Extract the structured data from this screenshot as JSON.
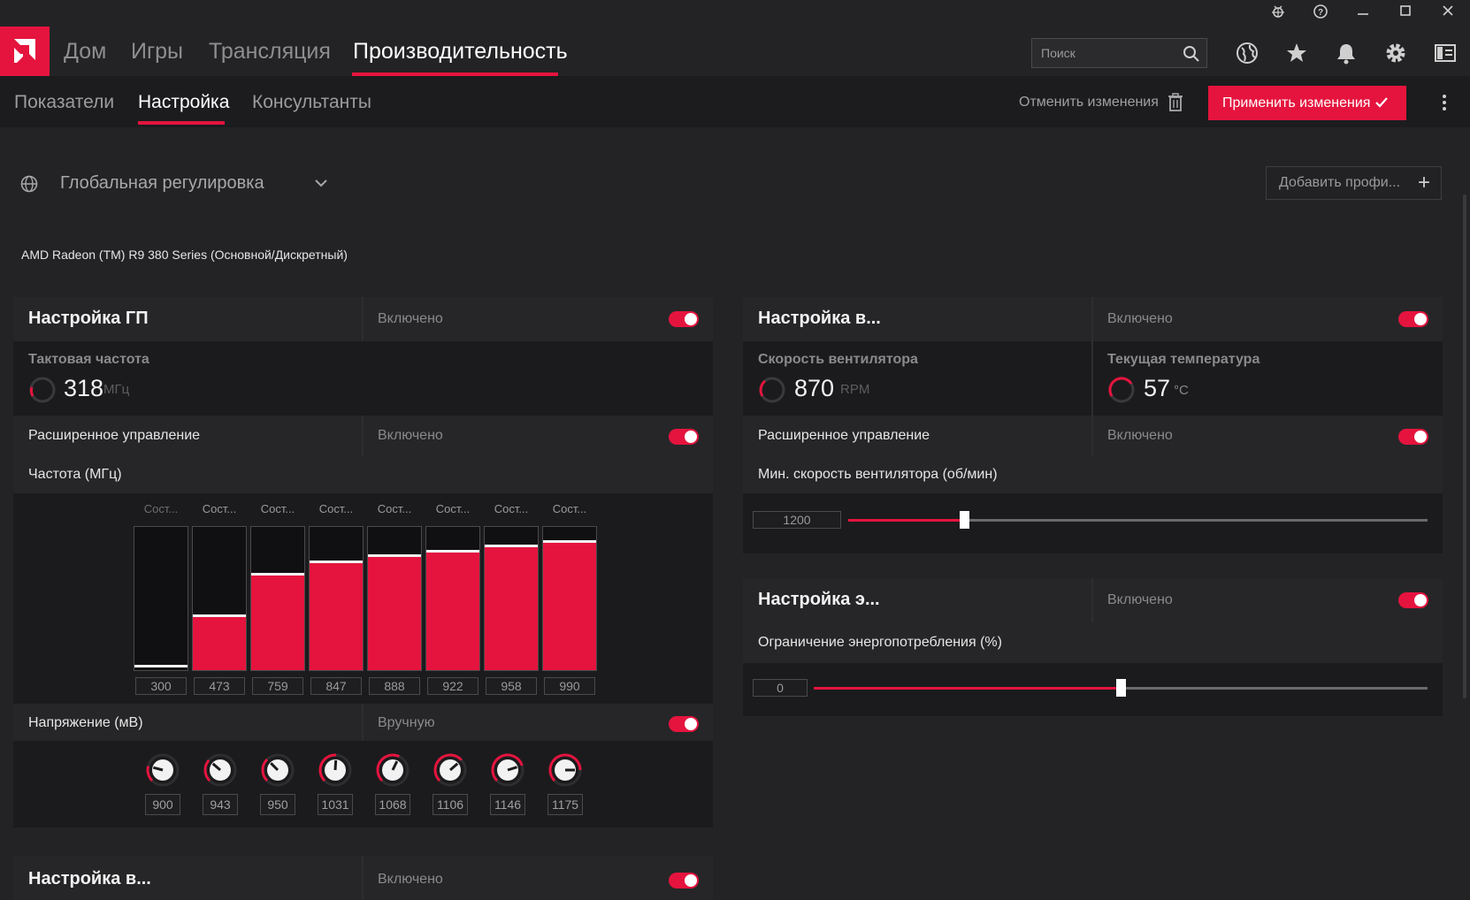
{
  "nav": {
    "items": [
      "Дом",
      "Игры",
      "Трансляция",
      "Производительность"
    ],
    "search_placeholder": "Поиск"
  },
  "subnav": {
    "items": [
      "Показатели",
      "Настройка",
      "Консультанты"
    ],
    "discard_label": "Отменить изменения",
    "apply_label": "Применить изменения"
  },
  "profile": {
    "name": "Глобальная регулировка",
    "add_label": "Добавить профи..."
  },
  "gpu_name": "AMD Radeon (TM) R9 380 Series (Основной/Дискретный)",
  "gpu_tuning": {
    "title": "Настройка ГП",
    "state": "Включено",
    "clock_label": "Тактовая частота",
    "clock_value": "318",
    "clock_unit": "МГц",
    "advanced_label": "Расширенное управление",
    "advanced_state": "Включено",
    "freq_label": "Частота (МГц)",
    "state_labels": [
      "Сост...",
      "Сост...",
      "Сост...",
      "Сост...",
      "Сост...",
      "Сост...",
      "Сост...",
      "Сост..."
    ],
    "frequencies": [
      300,
      473,
      759,
      847,
      888,
      922,
      958,
      990
    ],
    "voltage_label": "Напряжение (мВ)",
    "voltage_state": "Вручную",
    "voltages": [
      900,
      943,
      950,
      1031,
      1068,
      1106,
      1146,
      1175
    ]
  },
  "fan_tuning": {
    "title": "Настройка в...",
    "state": "Включено",
    "fan_speed_label": "Скорость вентилятора",
    "fan_speed_value": "870",
    "fan_speed_unit": "RPM",
    "temp_label": "Текущая температура",
    "temp_value": "57",
    "temp_unit": "°C",
    "advanced_label": "Расширенное управление",
    "advanced_state": "Включено",
    "min_speed_label": "Мин. скорость вентилятора (об/мин)",
    "min_speed_value": "1200",
    "min_speed_fraction": 0.2
  },
  "power_tuning": {
    "title": "Настройка э...",
    "state": "Включено",
    "limit_label": "Ограничение энергопотребления (%)",
    "limit_value": "0",
    "limit_fraction": 0.5
  },
  "vram_tuning": {
    "title": "Настройка в...",
    "state": "Включено"
  },
  "colors": {
    "accent": "#e5143e",
    "background": "#232325",
    "panel": "#1b1b1d"
  },
  "icons": [
    "bug-icon",
    "help-icon",
    "minimize-icon",
    "maximize-icon",
    "close-icon",
    "amd-logo-icon",
    "search-icon",
    "globe-icon",
    "star-icon",
    "bell-icon",
    "gear-icon",
    "sidebar-icon",
    "trash-icon",
    "check-icon",
    "more-icon",
    "chevron-down-icon",
    "plus-icon"
  ]
}
